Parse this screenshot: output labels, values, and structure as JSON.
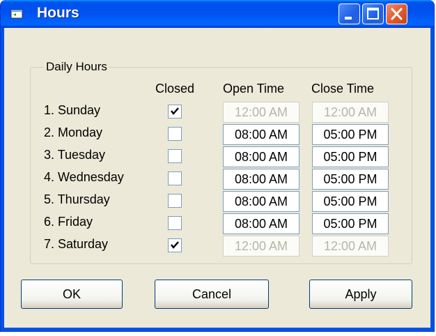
{
  "window": {
    "title": "Hours"
  },
  "group": {
    "legend": "Daily Hours"
  },
  "columns": {
    "closed": "Closed",
    "open_time": "Open Time",
    "close_time": "Close Time"
  },
  "days": [
    {
      "label": "1. Sunday",
      "closed": true,
      "open": "12:00 AM",
      "close": "12:00 AM"
    },
    {
      "label": "2. Monday",
      "closed": false,
      "open": "08:00 AM",
      "close": "05:00 PM"
    },
    {
      "label": "3. Tuesday",
      "closed": false,
      "open": "08:00 AM",
      "close": "05:00 PM"
    },
    {
      "label": "4. Wednesday",
      "closed": false,
      "open": "08:00 AM",
      "close": "05:00 PM"
    },
    {
      "label": "5. Thursday",
      "closed": false,
      "open": "08:00 AM",
      "close": "05:00 PM"
    },
    {
      "label": "6. Friday",
      "closed": false,
      "open": "08:00 AM",
      "close": "05:00 PM"
    },
    {
      "label": "7. Saturday",
      "closed": true,
      "open": "12:00 AM",
      "close": "12:00 AM"
    }
  ],
  "buttons": {
    "ok": "OK",
    "cancel": "Cancel",
    "apply": "Apply"
  },
  "colors": {
    "titlebar": "#0054e3",
    "client": "#ece9d8",
    "close_button": "#e05a2b"
  }
}
